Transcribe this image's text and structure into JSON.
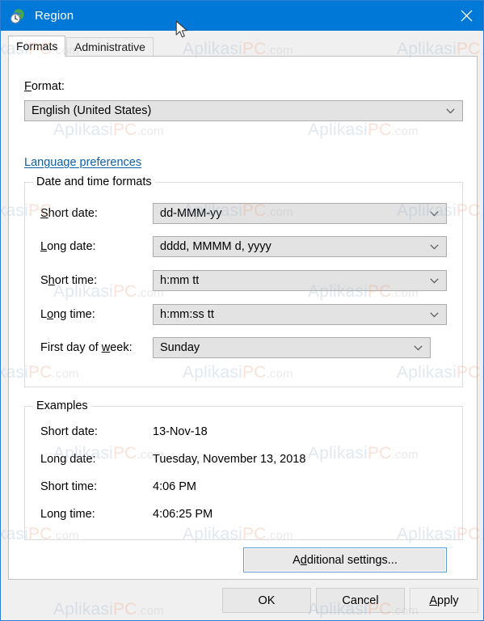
{
  "window": {
    "title": "Region",
    "app_icon": "region-globe-clock-icon",
    "close_label": "✕",
    "accent_color": "#0078d7",
    "border_color": "#2d7dd2"
  },
  "tabs": [
    {
      "label": "Formats",
      "active": true
    },
    {
      "label": "Administrative",
      "active": false
    }
  ],
  "format_section": {
    "label": "Format:",
    "accelerator": "F",
    "value": "English (United States)",
    "link_label": "Language preferences",
    "link_color": "#0f5fa6"
  },
  "date_time_group": {
    "title": "Date and time formats",
    "rows": [
      {
        "label": "Short date:",
        "accelerator": "S",
        "value": "dd-MMM-yy"
      },
      {
        "label": "Long date:",
        "accelerator": "L",
        "value": "dddd, MMMM d, yyyy"
      },
      {
        "label": "Short time:",
        "accelerator": "h",
        "value": "h:mm tt"
      },
      {
        "label": "Long time:",
        "accelerator": "o",
        "value": "h:mm:ss tt"
      },
      {
        "label": "First day of week:",
        "accelerator": "w",
        "value": "Sunday"
      }
    ]
  },
  "examples_group": {
    "title": "Examples",
    "rows": [
      {
        "label": "Short date:",
        "value": "13-Nov-18"
      },
      {
        "label": "Long date:",
        "value": "Tuesday, November 13, 2018"
      },
      {
        "label": "Short time:",
        "value": "4:06 PM"
      },
      {
        "label": "Long time:",
        "value": "4:06:25 PM"
      }
    ]
  },
  "buttons": {
    "additional_settings": "Additional settings...",
    "ok": "OK",
    "cancel": "Cancel",
    "apply": "Apply"
  },
  "watermark": {
    "part_a": "Aplikasi",
    "part_p": "PC",
    "part_c": ".com"
  }
}
